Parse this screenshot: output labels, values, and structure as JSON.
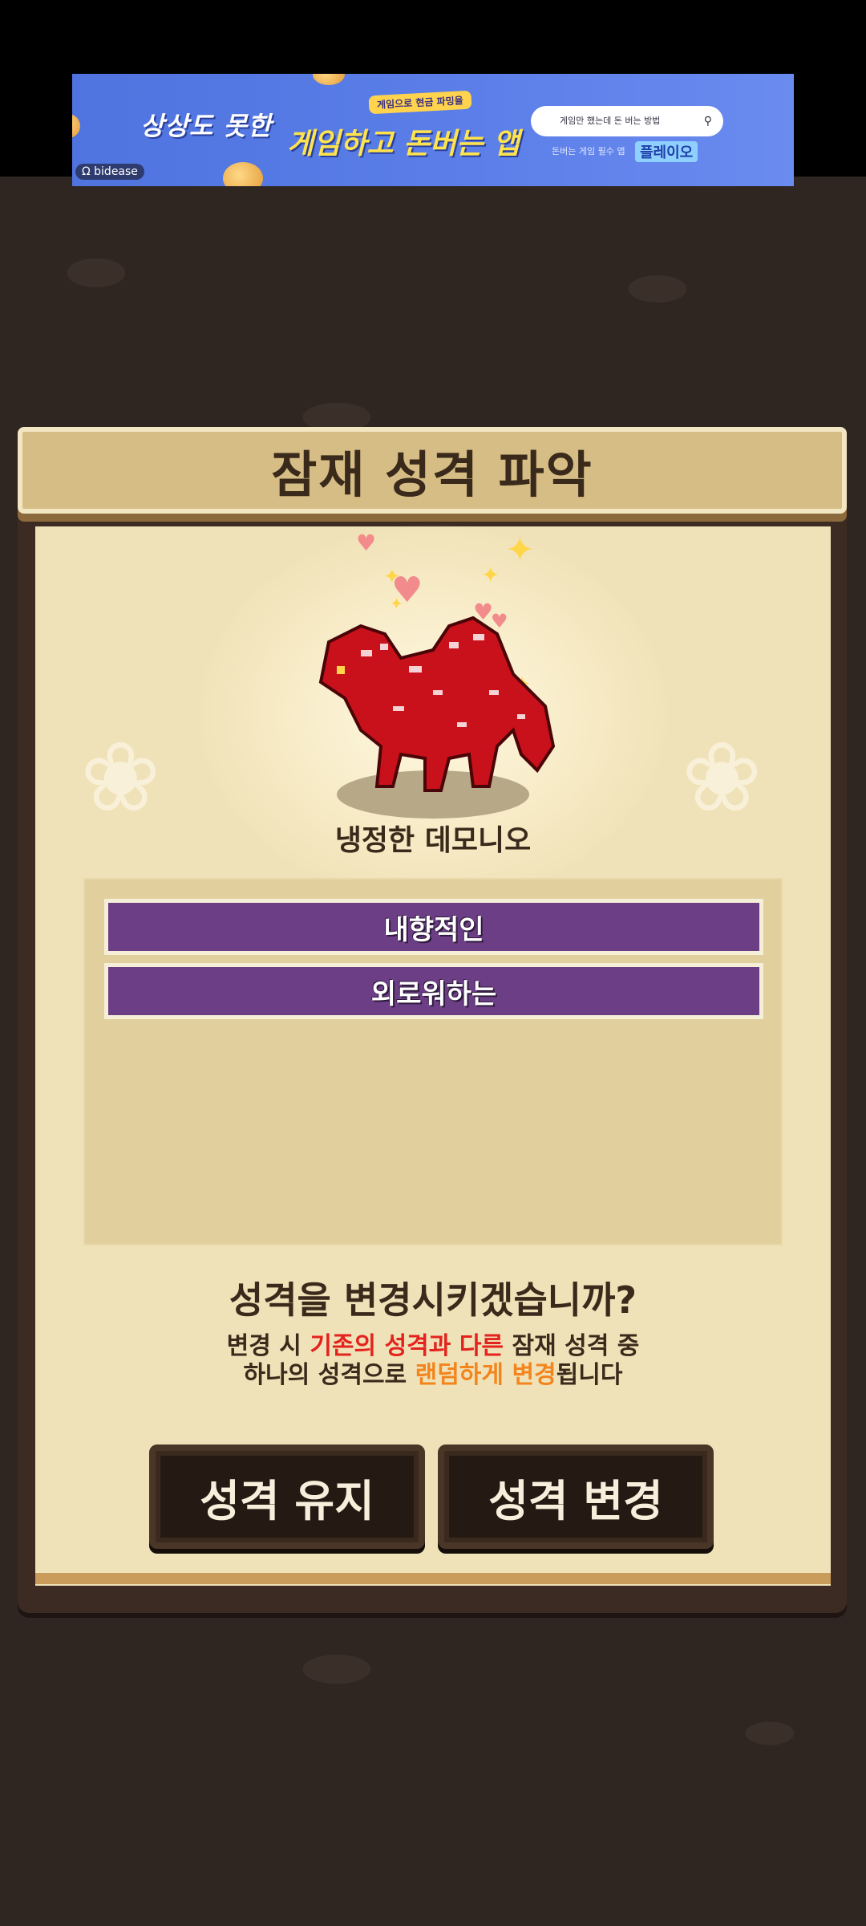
{
  "ad": {
    "headline_1": "상상도 못한",
    "badge": "게임으로 현금 파밍을",
    "headline_2": "게임하고 돈버는 앱",
    "search_text": "게임만 했는데 돈 버는 방법",
    "sub_text": "돈버는 게임 필수 앱",
    "brand": "플레이오",
    "network": "bidease"
  },
  "dialog": {
    "title": "잠재 성격 파악",
    "pet_name": "냉정한 데모니오",
    "traits": [
      "내향적인",
      "외로워하는"
    ],
    "question": "성격을 변경시키겠습니까?",
    "info": {
      "part1": "변경 시 ",
      "red": "기존의 성격과 다른",
      "part2": " 잠재 성격 중",
      "part3": "하나의 성격으로 ",
      "orange": "랜덤하게 변경",
      "part4": "됩니다"
    },
    "keep_button": "성격 유지",
    "change_button": "성격 변경"
  },
  "colors": {
    "trait_purple": "#6b3e86",
    "highlight_red": "#e3231e",
    "highlight_orange": "#f2851d",
    "panel": "#f0e2b8"
  }
}
